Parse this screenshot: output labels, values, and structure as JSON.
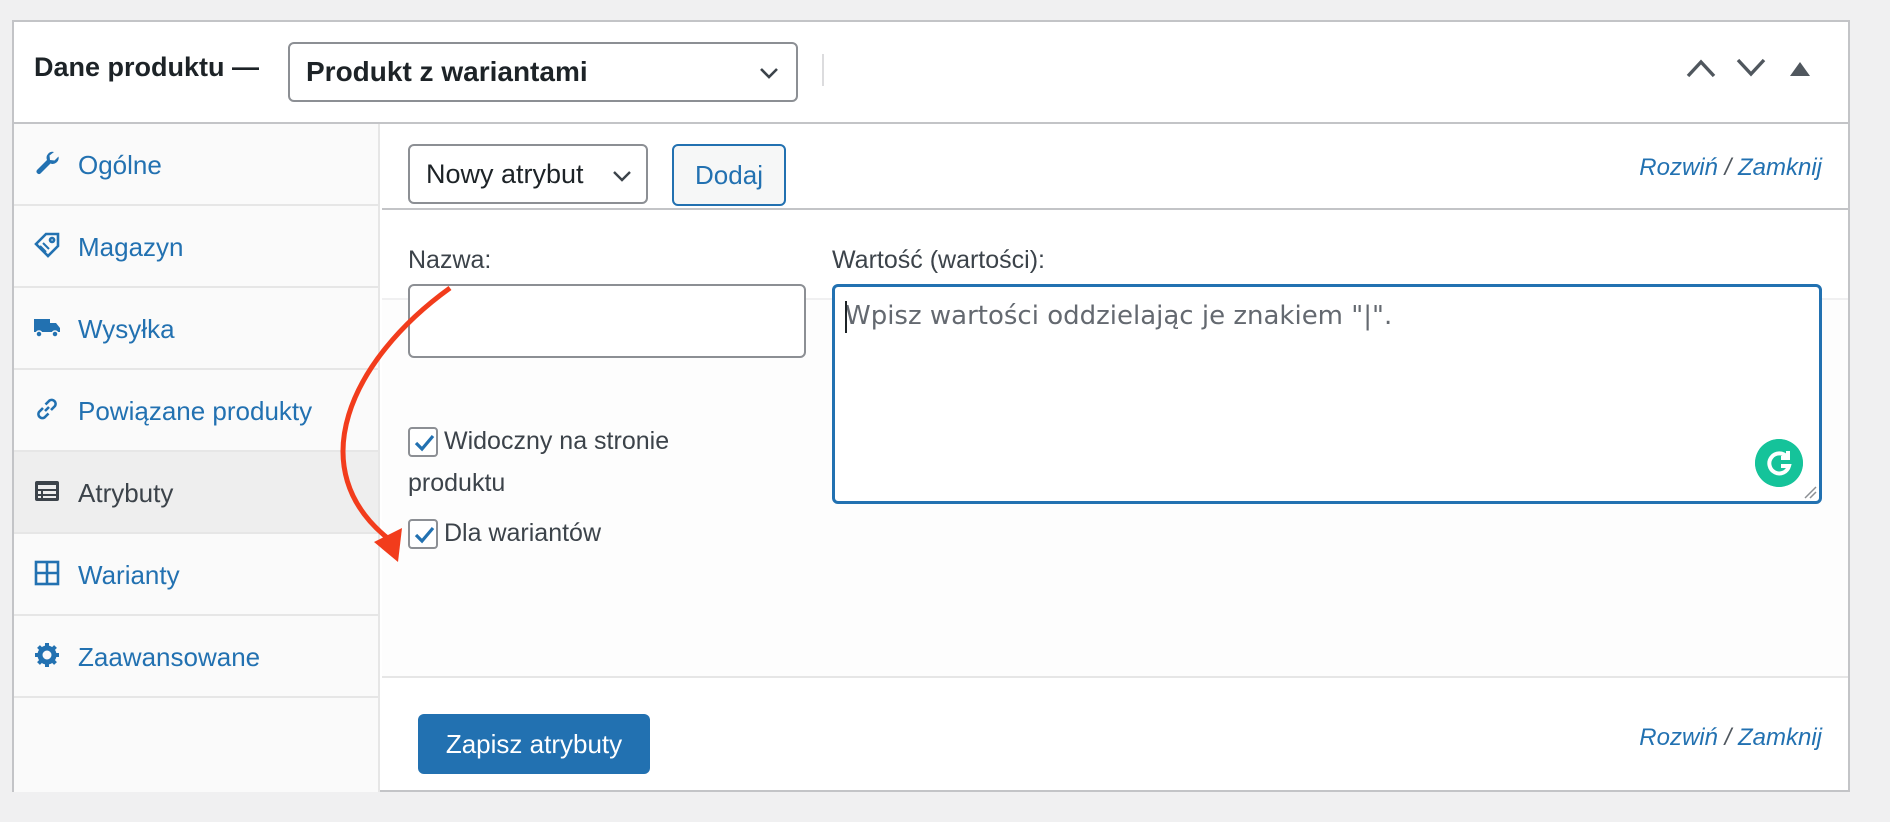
{
  "header": {
    "title": "Dane produktu —",
    "product_type": "Produkt z wariantami"
  },
  "sidebar": {
    "items": [
      {
        "label": "Ogólne",
        "icon": "wrench-icon",
        "active": false
      },
      {
        "label": "Magazyn",
        "icon": "tag-icon",
        "active": false
      },
      {
        "label": "Wysyłka",
        "icon": "truck-icon",
        "active": false
      },
      {
        "label": "Powiązane produkty",
        "icon": "link-icon",
        "active": false
      },
      {
        "label": "Atrybuty",
        "icon": "list-icon",
        "active": true
      },
      {
        "label": "Warianty",
        "icon": "grid-icon",
        "active": false
      },
      {
        "label": "Zaawansowane",
        "icon": "gear-icon",
        "active": false
      }
    ]
  },
  "toolbar": {
    "attribute_select": "Nowy atrybut",
    "add_label": "Dodaj",
    "expand": "Rozwiń",
    "separator": "/",
    "collapse": "Zamknij"
  },
  "attribute": {
    "name_label": "Nazwa:",
    "name_value": "",
    "value_label": "Wartość (wartości):",
    "value_placeholder": "Wpisz wartości oddzielając je znakiem \"|\".",
    "visible_label_1": "Widoczny na stronie",
    "visible_label_2": "produktu",
    "visible_checked": true,
    "variations_label": "Dla wariantów",
    "variations_checked": true
  },
  "footer": {
    "save_label": "Zapisz atrybuty"
  },
  "colors": {
    "accent": "#2271b1",
    "annotation_arrow": "#f23c1c",
    "grammarly": "#15c39a"
  }
}
